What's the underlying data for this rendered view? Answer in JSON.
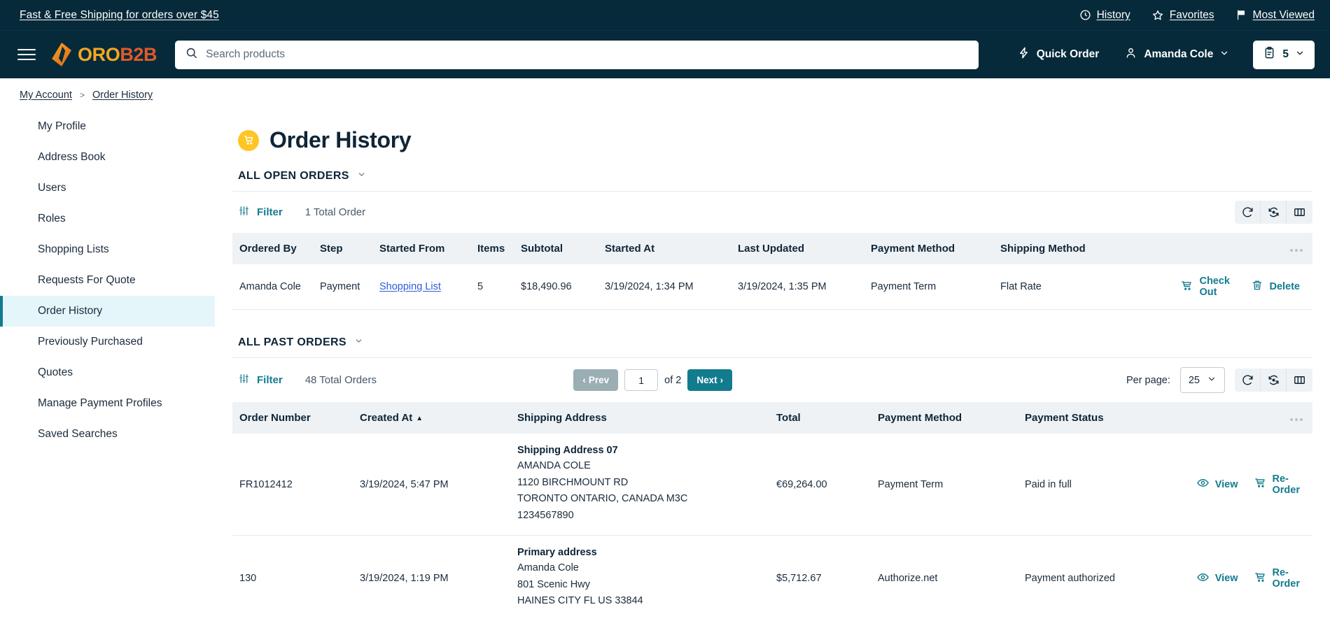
{
  "promo": {
    "text": "Fast & Free Shipping for orders over $45",
    "links": [
      {
        "label": "History",
        "icon": "clock-icon"
      },
      {
        "label": "Favorites",
        "icon": "star-icon"
      },
      {
        "label": "Most Viewed",
        "icon": "flag-icon"
      }
    ]
  },
  "header": {
    "logo": {
      "part1": "ORO",
      "part2": "B2B"
    },
    "search": {
      "value": "",
      "placeholder": "Search products"
    },
    "quick_order": "Quick Order",
    "account": "Amanda Cole",
    "cart_count": "5"
  },
  "breadcrumb": {
    "root": "My Account",
    "separator": ">",
    "current": "Order History"
  },
  "sidebar": {
    "items": [
      {
        "label": "My Profile",
        "active": false
      },
      {
        "label": "Address Book",
        "active": false
      },
      {
        "label": "Users",
        "active": false
      },
      {
        "label": "Roles",
        "active": false
      },
      {
        "label": "Shopping Lists",
        "active": false
      },
      {
        "label": "Requests For Quote",
        "active": false
      },
      {
        "label": "Order History",
        "active": true
      },
      {
        "label": "Previously Purchased",
        "active": false
      },
      {
        "label": "Quotes",
        "active": false
      },
      {
        "label": "Manage Payment Profiles",
        "active": false
      },
      {
        "label": "Saved Searches",
        "active": false
      }
    ]
  },
  "page": {
    "title": "Order History",
    "title_icon": "cart-icon"
  },
  "open_orders": {
    "section_label": "ALL OPEN ORDERS",
    "filter_label": "Filter",
    "total_label": "1 Total Order",
    "columns": [
      "Ordered By",
      "Step",
      "Started From",
      "Items",
      "Subtotal",
      "Started At",
      "Last Updated",
      "Payment Method",
      "Shipping Method"
    ],
    "rows": [
      {
        "ordered_by": "Amanda Cole",
        "step": "Payment",
        "started_from": "Shopping List",
        "items": "5",
        "subtotal": "$18,490.96",
        "started_at": "3/19/2024, 1:34 PM",
        "last_updated": "3/19/2024, 1:35 PM",
        "payment_method": "Payment Term",
        "shipping_method": "Flat Rate",
        "action_checkout": "Check Out",
        "action_delete": "Delete"
      }
    ]
  },
  "past_orders": {
    "section_label": "ALL PAST ORDERS",
    "filter_label": "Filter",
    "total_label": "48 Total Orders",
    "pagination": {
      "prev": "Prev",
      "page": "1",
      "of": "of 2",
      "next": "Next"
    },
    "per_page_label": "Per page:",
    "per_page_value": "25",
    "columns": [
      "Order Number",
      "Created At",
      "Shipping Address",
      "Total",
      "Payment Method",
      "Payment Status"
    ],
    "sort_column": "Created At",
    "sort_direction": "asc",
    "rows": [
      {
        "order_number": "FR1012412",
        "created_at": "3/19/2024, 5:47 PM",
        "address_title": "Shipping Address 07",
        "address_lines": [
          "AMANDA COLE",
          "1120 BIRCHMOUNT RD",
          "TORONTO ONTARIO, CANADA M3C",
          "1234567890"
        ],
        "total": "€69,264.00",
        "payment_method": "Payment Term",
        "payment_status": "Paid in full",
        "action_view": "View",
        "action_reorder": "Re-Order"
      },
      {
        "order_number": "130",
        "created_at": "3/19/2024, 1:19 PM",
        "address_title": "Primary address",
        "address_lines": [
          "Amanda Cole",
          "801 Scenic Hwy",
          "HAINES CITY FL US 33844"
        ],
        "total": "$5,712.67",
        "payment_method": "Authorize.net",
        "payment_status": "Payment authorized",
        "action_view": "View",
        "action_reorder": "Re-Order"
      }
    ]
  },
  "icons": {
    "refresh": "refresh-icon",
    "reset": "reset-icon",
    "columns": "columns-icon",
    "filter": "filter-icon",
    "overflow": "overflow-menu-icon"
  },
  "colors": {
    "header_bg": "#062a3a",
    "accent": "#137b8e",
    "link": "#2f5bd8",
    "badge": "#ffc523",
    "active_row": "#e4f6fa"
  }
}
